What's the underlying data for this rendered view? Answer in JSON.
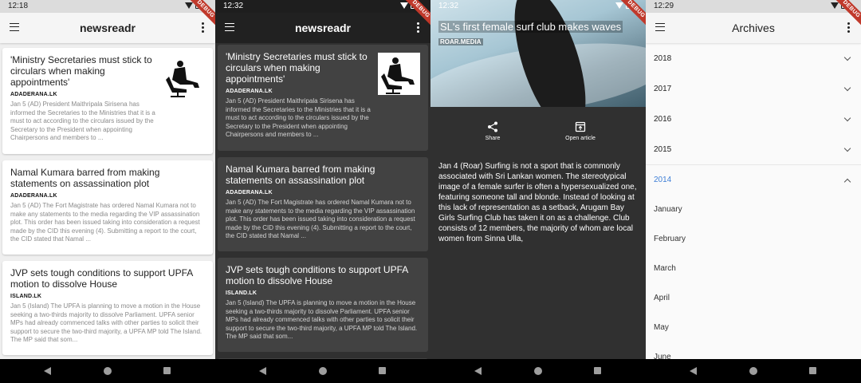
{
  "panels": [
    {
      "status_time": "12:18",
      "app_title": "newsreadr",
      "debug_label": "DEBUG",
      "cards": [
        {
          "headline": "'Ministry Secretaries must stick to circulars when making appointments'",
          "source": "ADADERANA.LK",
          "summary": "Jan 5 (AD) President Maithripala Sirisena has informed the Secretaries to the Ministries that it is a must to act according to the circulars issued by the Secretary to the President when appointing Chairpersons and members to ..."
        },
        {
          "headline": "Namal Kumara barred from making statements on assassination plot",
          "source": "ADADERANA.LK",
          "summary": "Jan 5 (AD) The Fort Magistrate has ordered Namal Kumara not to make any statements to the media regarding the VIP assassination plot. This order has been issued taking into consideration a request made by the CID this evening (4). Submitting a report to the court, the CID stated that Namal ..."
        },
        {
          "headline": "JVP sets tough conditions to support UPFA motion to dissolve House",
          "source": "ISLAND.LK",
          "summary": "Jan 5 (Island) The UPFA is planning to move a motion in the House seeking a two-thirds majority to dissolve Parliament. UPFA senior MPs had already commenced talks with other parties to solicit their support to secure the two-third majority, a UPFA MP told The Island. The MP said that som..."
        }
      ]
    },
    {
      "status_time": "12:32",
      "app_title": "newsreadr",
      "debug_label": "DEBUG",
      "cards": [
        {
          "headline": "'Ministry Secretaries must stick to circulars when making appointments'",
          "source": "ADADERANA.LK",
          "summary": "Jan 5 (AD) President Maithripala Sirisena has informed the Secretaries to the Ministries that it is a must to act according to the circulars issued by the Secretary to the President when appointing Chairpersons and members to ..."
        },
        {
          "headline": "Namal Kumara barred from making statements on assassination plot",
          "source": "ADADERANA.LK",
          "summary": "Jan 5 (AD) The Fort Magistrate has ordered Namal Kumara not to make any statements to the media regarding the VIP assassination plot. This order has been issued taking into consideration a request made by the CID this evening (4). Submitting a report to the court, the CID stated that Namal ..."
        },
        {
          "headline": "JVP sets tough conditions to support UPFA motion to dissolve House",
          "source": "ISLAND.LK",
          "summary": "Jan 5 (Island) The UPFA is planning to move a motion in the House seeking a two-thirds majority to dissolve Parliament. UPFA senior MPs had already commenced talks with other parties to solicit their support to secure the two-third majority, a UPFA MP told The Island. The MP said that som..."
        }
      ]
    },
    {
      "status_time": "12:32",
      "debug_label": "DEBUG",
      "article_title": "SL's first female surf club makes waves",
      "article_source": "ROAR.MEDIA",
      "share_label": "Share",
      "open_label": "Open article",
      "body": "Jan 4 (Roar) Surfing is not a sport that is commonly associated with Sri Lankan women. The stereotypical image of a female surfer is often a hypersexualized one, featuring someone tall and blonde. Instead of looking at this lack of representation as a setback, Arugam Bay Girls Surfing Club has taken it on as a challenge. Club consists of 12 members, the majority of whom are local women from Sinna Ulla,"
    },
    {
      "status_time": "12:29",
      "app_title": "Archives",
      "debug_label": "DEBUG",
      "years": [
        "2018",
        "2017",
        "2016",
        "2015"
      ],
      "expanded_year": "2014",
      "months": [
        "January",
        "February",
        "March",
        "April",
        "May",
        "June"
      ],
      "accent_color": "#3f7fd6"
    }
  ]
}
